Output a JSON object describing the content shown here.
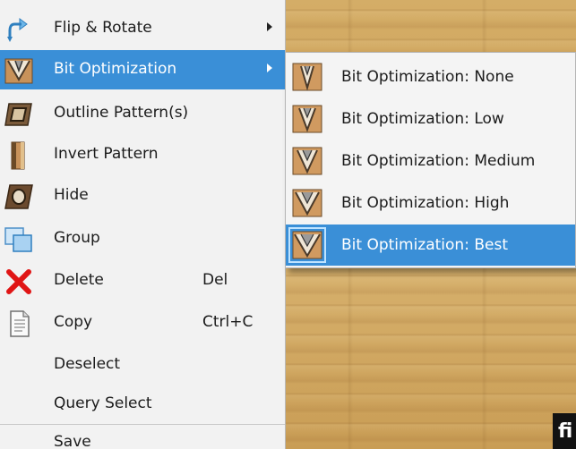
{
  "main_menu": {
    "items": [
      {
        "label": "Flip & Rotate",
        "icon": "flip-rotate-icon",
        "has_submenu": true
      },
      {
        "label": "Bit Optimization",
        "icon": "bit-optimization-icon",
        "has_submenu": true,
        "highlighted": true
      },
      {
        "label": "Outline Pattern(s)",
        "icon": "outline-pattern-icon"
      },
      {
        "label": "Invert Pattern",
        "icon": "invert-pattern-icon"
      },
      {
        "label": "Hide",
        "icon": "hide-icon"
      },
      {
        "label": "Group",
        "icon": "group-icon"
      },
      {
        "label": "Delete",
        "icon": "delete-icon",
        "shortcut": "Del"
      },
      {
        "label": "Copy",
        "icon": "copy-icon",
        "shortcut": "Ctrl+C"
      },
      {
        "label": "Deselect"
      },
      {
        "label": "Query Select"
      },
      {
        "label": "Save"
      }
    ]
  },
  "submenu": {
    "items": [
      {
        "label": "Bit Optimization: None"
      },
      {
        "label": "Bit Optimization: Low"
      },
      {
        "label": "Bit Optimization: Medium"
      },
      {
        "label": "Bit Optimization: High"
      },
      {
        "label": "Bit Optimization: Best",
        "highlighted": true
      }
    ]
  },
  "corner_badge": {
    "text": "fi"
  },
  "colors": {
    "highlight": "#3a8fd7",
    "menu_bg": "#f2f2f2",
    "wood": "#cfa45c"
  }
}
